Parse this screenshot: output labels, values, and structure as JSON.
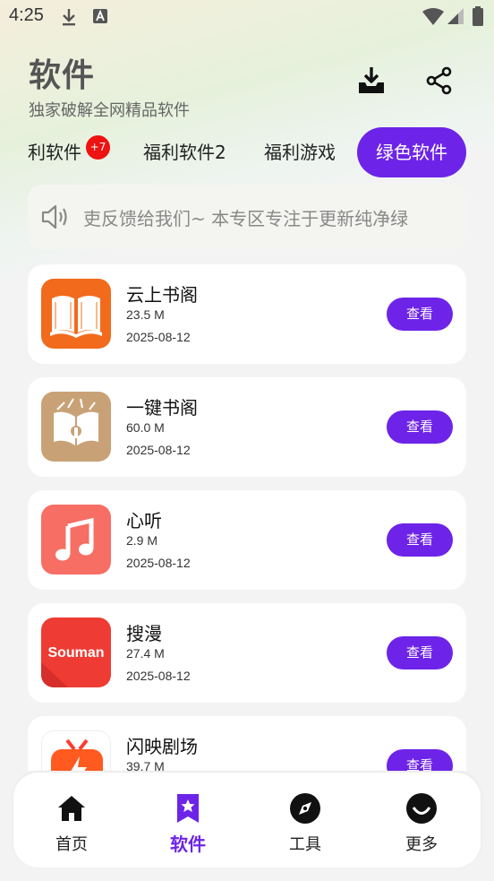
{
  "status_bar": {
    "time": "4:25",
    "download_icon": "download-arrow-icon",
    "notification_icon": "a-letter-icon",
    "wifi_icon": "wifi-icon",
    "signal_icon": "signal-icon",
    "battery_icon": "battery-icon"
  },
  "header": {
    "title": "软件",
    "subtitle": "独家破解全网精品软件",
    "download_icon": "download-tray-icon",
    "share_icon": "share-icon"
  },
  "tabs": [
    {
      "label": "利软件",
      "badge": "+7",
      "active": false
    },
    {
      "label": "福利软件2",
      "active": false
    },
    {
      "label": "福利游戏",
      "active": false
    },
    {
      "label": "绿色软件",
      "active": true
    }
  ],
  "notice": {
    "icon": "speaker-icon",
    "text": "吏反馈给我们~   本专区专注于更新纯净绿"
  },
  "apps": [
    {
      "name": "云上书阁",
      "size": "23.5 M",
      "date": "2025-08-12",
      "button": "查看",
      "icon": "book-icon",
      "color": "#f26a1b"
    },
    {
      "name": "一键书阁",
      "size": "60.0 M",
      "date": "2025-08-12",
      "button": "查看",
      "icon": "open-book-icon",
      "color": "#c8a276"
    },
    {
      "name": "心听",
      "size": "2.9 M",
      "date": "2025-08-12",
      "button": "查看",
      "icon": "music-note-icon",
      "color": "#f76e64"
    },
    {
      "name": "搜漫",
      "size": "27.4 M",
      "date": "2025-08-12",
      "button": "查看",
      "icon": "souman-logo-icon",
      "icon_text": "Souman",
      "color": "#ee3c34"
    },
    {
      "name": "闪映剧场",
      "size": "39.7 M",
      "date": "",
      "button": "查看",
      "icon": "tv-icon",
      "color": "#ff5a1f"
    }
  ],
  "bottom_nav": [
    {
      "label": "首页",
      "icon": "home-icon",
      "active": false
    },
    {
      "label": "软件",
      "icon": "bookmark-star-icon",
      "active": true
    },
    {
      "label": "工具",
      "icon": "compass-icon",
      "active": false
    },
    {
      "label": "更多",
      "icon": "smile-circle-icon",
      "active": false
    }
  ],
  "colors": {
    "accent": "#6d24e8",
    "badge": "#ee1212"
  }
}
